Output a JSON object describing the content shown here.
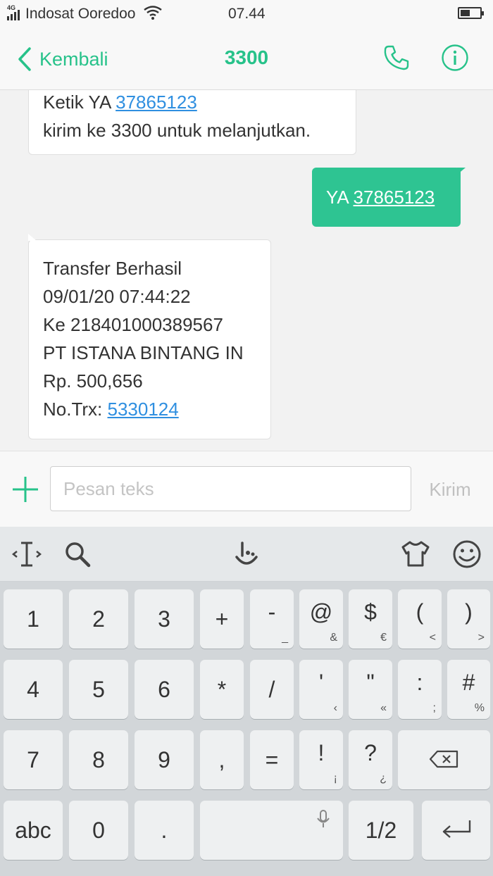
{
  "status_bar": {
    "network": "4G",
    "carrier": "Indosat Ooredoo",
    "time": "07.44"
  },
  "nav": {
    "back_label": "Kembali",
    "title": "3300",
    "call_icon": "phone-icon",
    "info_icon": "info-icon"
  },
  "messages": {
    "m1": {
      "prefix": "Ketik YA ",
      "code": "37865123",
      "line2": "kirim ke 3300 untuk melanjutkan."
    },
    "m2": {
      "prefix": "YA ",
      "code": "37865123"
    },
    "m3": {
      "line1": "Transfer Berhasil",
      "line2": "09/01/20 07:44:22",
      "line3": "Ke 218401000389567",
      "line4": "PT ISTANA BINTANG IN",
      "line5": "Rp. 500,656",
      "trx_prefix": "No.Trx: ",
      "trx": "5330124"
    }
  },
  "compose": {
    "placeholder": "Pesan teks",
    "send_label": "Kirim",
    "add_icon": "plus-icon"
  },
  "keyboard": {
    "toolbar": [
      "cursor-icon",
      "search-icon",
      "touchpal-icon",
      "theme-icon",
      "emoji-icon"
    ],
    "row1": [
      {
        "main": "1",
        "sub": ""
      },
      {
        "main": "2",
        "sub": ""
      },
      {
        "main": "3",
        "sub": ""
      },
      {
        "main": "+",
        "sub": ""
      },
      {
        "main": "-",
        "sub": "_"
      },
      {
        "main": "@",
        "sub": "&"
      },
      {
        "main": "$",
        "sub": "€"
      },
      {
        "main": "(",
        "sub": "<"
      },
      {
        "main": ")",
        "sub": ">"
      }
    ],
    "row2": [
      {
        "main": "4",
        "sub": ""
      },
      {
        "main": "5",
        "sub": ""
      },
      {
        "main": "6",
        "sub": ""
      },
      {
        "main": "*",
        "sub": ""
      },
      {
        "main": "/",
        "sub": ""
      },
      {
        "main": "'",
        "sub": "‹"
      },
      {
        "main": "\"",
        "sub": "«"
      },
      {
        "main": ":",
        "sub": ";"
      },
      {
        "main": "#",
        "sub": "%"
      }
    ],
    "row3": [
      {
        "main": "7",
        "sub": ""
      },
      {
        "main": "8",
        "sub": ""
      },
      {
        "main": "9",
        "sub": ""
      },
      {
        "main": ",",
        "sub": ""
      },
      {
        "main": "=",
        "sub": ""
      },
      {
        "main": "!",
        "sub": "¡"
      },
      {
        "main": "?",
        "sub": "¿"
      }
    ],
    "row4": {
      "abc": "abc",
      "zero": "0",
      "dot": ".",
      "page": "1/2"
    }
  }
}
